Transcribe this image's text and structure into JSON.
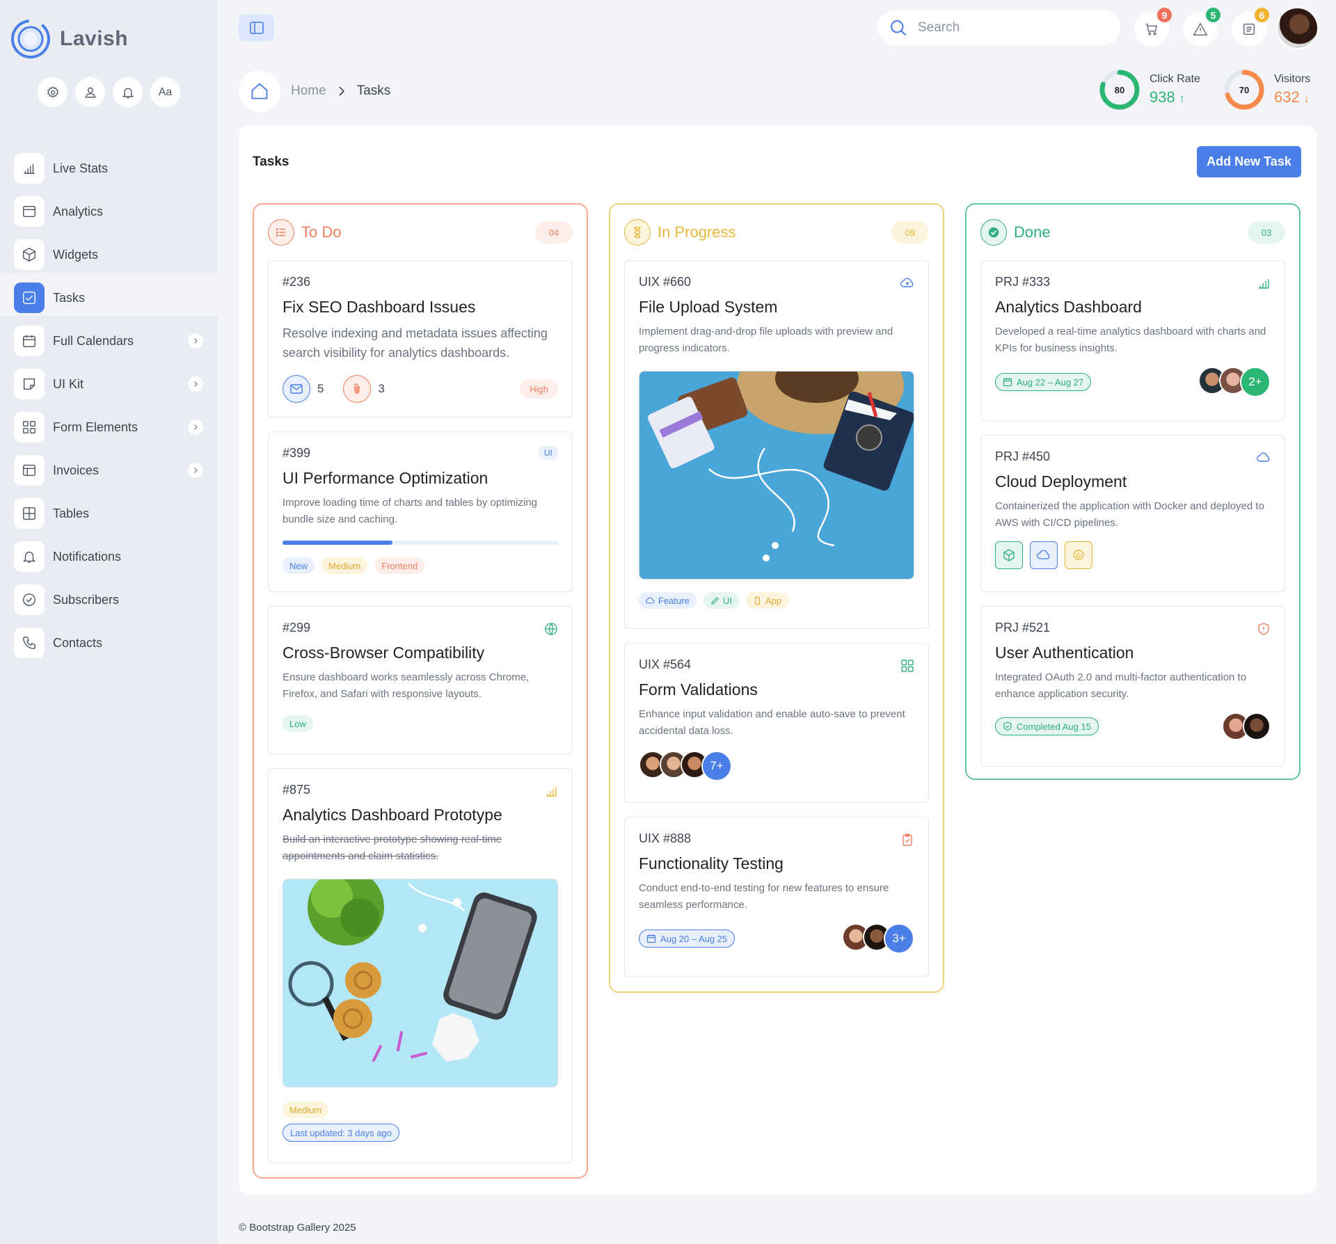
{
  "brand": {
    "name": "Lavish"
  },
  "quick_actions": {
    "font_label": "Aa"
  },
  "sidebar": {
    "items": [
      {
        "label": "Live Stats",
        "icon": "bar-chart-icon"
      },
      {
        "label": "Analytics",
        "icon": "window-icon"
      },
      {
        "label": "Widgets",
        "icon": "box-icon"
      },
      {
        "label": "Tasks",
        "icon": "check-square-icon",
        "active": true
      },
      {
        "label": "Full Calendars",
        "icon": "calendar-icon",
        "submenu": true
      },
      {
        "label": "UI Kit",
        "icon": "sticky-icon",
        "submenu": true
      },
      {
        "label": "Form Elements",
        "icon": "grid-icon",
        "submenu": true
      },
      {
        "label": "Invoices",
        "icon": "layout-icon",
        "submenu": true
      },
      {
        "label": "Tables",
        "icon": "table-icon"
      },
      {
        "label": "Notifications",
        "icon": "bell-icon"
      },
      {
        "label": "Subscribers",
        "icon": "check-circle-icon"
      },
      {
        "label": "Contacts",
        "icon": "phone-icon"
      }
    ]
  },
  "topbar": {
    "search_placeholder": "Search",
    "cart_badge": "9",
    "alerts_badge": "5",
    "messages_badge": "6",
    "colors": {
      "red": "#f0715b",
      "green": "#2bb673",
      "yellow": "#f2b531"
    }
  },
  "breadcrumb": {
    "home": "Home",
    "current": "Tasks"
  },
  "stats": [
    {
      "label": "Click Rate",
      "ring_value": "80",
      "value": "938",
      "trend": "up",
      "percent": 80,
      "color": "#2bb673"
    },
    {
      "label": "Visitors",
      "ring_value": "70",
      "value": "632",
      "trend": "down",
      "percent": 70,
      "color": "#f58a4b"
    }
  ],
  "page": {
    "title": "Tasks",
    "add_button": "Add New Task"
  },
  "columns": {
    "todo": {
      "title": "To Do",
      "count": "04",
      "color": "#ef7d5e"
    },
    "progress": {
      "title": "In Progress",
      "count": "09",
      "color": "#e8b83a"
    },
    "done": {
      "title": "Done",
      "count": "03",
      "color": "#2fae86"
    }
  },
  "todo_cards": [
    {
      "id": "#236",
      "title": "Fix SEO Dashboard Issues",
      "desc": "Resolve indexing and metadata issues affecting search visibility for analytics dashboards.",
      "mail_count": "5",
      "attach_count": "3",
      "priority": "High"
    },
    {
      "id": "#399",
      "title": "UI Performance Optimization",
      "desc": "Improve loading time of charts and tables by optimizing bundle size and caching.",
      "corner_tag": "UI",
      "progress": 0.4,
      "tags": [
        "New",
        "Medium",
        "Frontend"
      ]
    },
    {
      "id": "#299",
      "title": "Cross-Browser Compatibility",
      "desc": "Ensure dashboard works seamlessly across Chrome, Firefox, and Safari with responsive layouts.",
      "tag": "Low"
    },
    {
      "id": "#875",
      "title": "Analytics Dashboard Prototype",
      "desc": "Build an interactive prototype showing real-time appointments and claim statistics.",
      "tag": "Medium",
      "updated": "Last updated: 3 days ago"
    }
  ],
  "progress_cards": [
    {
      "id": "UIX #660",
      "title": "File Upload System",
      "desc": "Implement drag-and-drop file uploads with preview and progress indicators.",
      "tags": [
        "Feature",
        "UI",
        "App"
      ]
    },
    {
      "id": "UIX #564",
      "title": "Form Validations",
      "desc": "Enhance input validation and enable auto-save to prevent accidental data loss.",
      "more": "7+"
    },
    {
      "id": "UIX #888",
      "title": "Functionality Testing",
      "desc": "Conduct end-to-end testing for new features to ensure seamless performance.",
      "dates": "Aug 20 – Aug 25",
      "more": "3+"
    }
  ],
  "done_cards": [
    {
      "id": "PRJ #333",
      "title": "Analytics Dashboard",
      "desc": "Developed a real-time analytics dashboard with charts and KPIs for business insights.",
      "dates": "Aug 22 – Aug 27",
      "more": "2+"
    },
    {
      "id": "PRJ #450",
      "title": "Cloud Deployment",
      "desc": "Containerized the application with Docker and deployed to AWS with CI/CD pipelines."
    },
    {
      "id": "PRJ #521",
      "title": "User Authentication",
      "desc": "Integrated OAuth 2.0 and multi-factor authentication to enhance application security.",
      "status": "Completed Aug 15"
    }
  ],
  "footer": "© Bootstrap Gallery 2025"
}
